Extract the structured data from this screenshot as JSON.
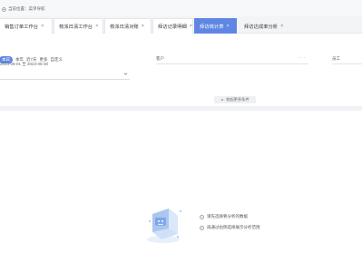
{
  "location": {
    "text": "当前位置：菜单导航"
  },
  "tabs": [
    {
      "label": "销售订单工作台",
      "active": false
    },
    {
      "label": "核派日清工作台",
      "active": false
    },
    {
      "label": "核派日清对账",
      "active": false
    },
    {
      "label": "拜访记录明细",
      "active": false
    },
    {
      "label": "拜访统计表",
      "active": true
    },
    {
      "label": "拜访达成率分析",
      "active": false
    }
  ],
  "tab_close_glyph": "×",
  "filters": {
    "date": {
      "options": [
        "本日",
        "本年",
        "近7天",
        "更多",
        "自定义"
      ],
      "selected": "本日",
      "range": "2023-06-01 至 2023-06-30"
    },
    "customer_label": "客户",
    "customer_more": "···",
    "employee_label": "员工",
    "expand_label": "收起更多条件"
  },
  "empty_state": {
    "tips": [
      "请先选择要分析的数据",
      "再通过右侧选择展示分析范围"
    ]
  },
  "colors": {
    "accent": "#5f86e3",
    "tab_bar": "#f3f4f6",
    "divider": "#f1f2f5"
  }
}
